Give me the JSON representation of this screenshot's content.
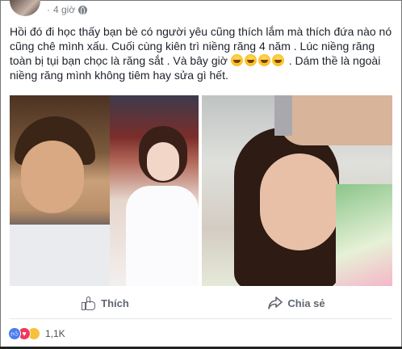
{
  "post": {
    "time": "4 giờ",
    "text_lines": [
      "Hồi đó đi học thấy bạn bè có người yêu cũng thích lắm mà thích đứa nào nó",
      "cũng chê mình xấu. Cuối cùng kiên trì niềng răng 4 năm . Lúc niềng răng",
      "toàn bị tụi bạn chọc là răng sắt . Và bây giờ",
      ". Dám thề là ngoài",
      "niềng răng mình không tiêm hay sửa gì hết."
    ]
  },
  "actions": {
    "like_label": "Thích",
    "share_label": "Chia sẻ"
  },
  "reactions": {
    "count": "1,1K",
    "types": [
      "like",
      "love",
      "haha"
    ]
  },
  "icons": {
    "like": "thumbs-up-icon",
    "share": "share-arrow-icon",
    "privacy": "globe-icon"
  },
  "colors": {
    "text": "#1d2129",
    "muted": "#606770",
    "like_blue": "#4a7df0",
    "love_red": "#f0385a",
    "haha_yellow": "#f7c23b"
  }
}
